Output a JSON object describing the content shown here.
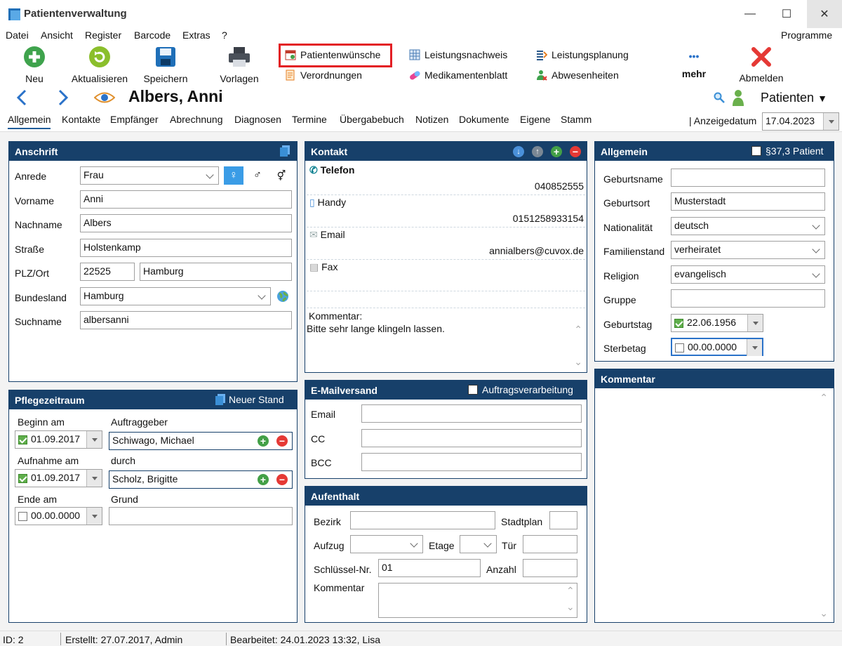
{
  "window": {
    "title": "Patientenverwaltung",
    "minimize": "—",
    "maximize": "☐",
    "close": "✕"
  },
  "menu": {
    "items": [
      "Datei",
      "Ansicht",
      "Register",
      "Barcode",
      "Extras",
      "?"
    ],
    "right": "Programme"
  },
  "toolbar": {
    "neu": "Neu",
    "aktualisieren": "Aktualisieren",
    "speichern": "Speichern",
    "vorlagen": "Vorlagen",
    "patientenwuensche": "Patientenwünsche",
    "verordnungen": "Verordnungen",
    "leistungsnachweis": "Leistungsnachweis",
    "medikamentenblatt": "Medikamentenblatt",
    "leistungsplanung": "Leistungsplanung",
    "abwesenheiten": "Abwesenheiten",
    "mehr_dots": "•••",
    "mehr": "mehr",
    "abmelden": "Abmelden"
  },
  "nav": {
    "patient_name": "Albers, Anni",
    "patienten_label": "Patienten"
  },
  "tabs": [
    "Allgemein",
    "Kontakte",
    "Empfänger",
    "Abrechnung",
    "Diagnosen",
    "Termine",
    "Übergabebuch",
    "Notizen",
    "Dokumente",
    "Eigene",
    "Stamm"
  ],
  "anzeigedatum": {
    "label": "Anzeigedatum",
    "value": "17.04.2023"
  },
  "anschrift": {
    "title": "Anschrift",
    "anrede_label": "Anrede",
    "anrede": "Frau",
    "vorname_label": "Vorname",
    "vorname": "Anni",
    "nachname_label": "Nachname",
    "nachname": "Albers",
    "strasse_label": "Straße",
    "strasse": "Holstenkamp",
    "plzort_label": "PLZ/Ort",
    "plz": "22525",
    "ort": "Hamburg",
    "bundesland_label": "Bundesland",
    "bundesland": "Hamburg",
    "suchname_label": "Suchname",
    "suchname": "albersanni",
    "female": "♀",
    "male": "♂",
    "other": "⚥"
  },
  "kontakt": {
    "title": "Kontakt",
    "telefon_label": "Telefon",
    "telefon": "040852555",
    "handy_label": "Handy",
    "handy": "0151258933154",
    "email_label": "Email",
    "email": "annialbers@cuvox.de",
    "fax_label": "Fax",
    "kommentar_label": "Kommentar:",
    "kommentar": "Bitte sehr lange klingeln lassen."
  },
  "allgemein": {
    "title": "Allgemein",
    "paragraph_label": "§37,3 Patient",
    "geburtsname_label": "Geburtsname",
    "geburtsname": "",
    "geburtsort_label": "Geburtsort",
    "geburtsort": "Musterstadt",
    "nationalitaet_label": "Nationalität",
    "nationalitaet": "deutsch",
    "familienstand_label": "Familienstand",
    "familienstand": "verheiratet",
    "religion_label": "Religion",
    "religion": "evangelisch",
    "gruppe_label": "Gruppe",
    "gruppe": "",
    "geburtstag_label": "Geburtstag",
    "geburtstag": "22.06.1956",
    "sterbetag_label": "Sterbetag",
    "sterbetag": "00.00.0000"
  },
  "pflegezeitraum": {
    "title": "Pflegezeitraum",
    "neuer_stand": "Neuer Stand",
    "beginn_label": "Beginn am",
    "beginn": "01.09.2017",
    "auftraggeber_label": "Auftraggeber",
    "auftraggeber": "Schiwago, Michael",
    "aufnahme_label": "Aufnahme am",
    "aufnahme": "01.09.2017",
    "durch_label": "durch",
    "durch": "Scholz, Brigitte",
    "ende_label": "Ende am",
    "ende": "00.00.0000",
    "grund_label": "Grund",
    "grund": ""
  },
  "emailversand": {
    "title": "E-Mailversand",
    "auftrag_label": "Auftragsverarbeitung",
    "email_label": "Email",
    "cc_label": "CC",
    "bcc_label": "BCC"
  },
  "aufenthalt": {
    "title": "Aufenthalt",
    "bezirk_label": "Bezirk",
    "stadtplan_label": "Stadtplan",
    "aufzug_label": "Aufzug",
    "etage_label": "Etage",
    "tuer_label": "Tür",
    "schluessel_label": "Schlüssel-Nr.",
    "schluessel": "01",
    "anzahl_label": "Anzahl",
    "kommentar_label": "Kommentar"
  },
  "kommentar": {
    "title": "Kommentar"
  },
  "status": {
    "id": "ID: 2",
    "erstellt": "Erstellt: 27.07.2017, Admin",
    "bearbeitet": "Bearbeitet: 24.01.2023 13:32, Lisa"
  },
  "colors": {
    "panel_header": "#17406a",
    "highlight": "#e31e24",
    "add": "#43a047",
    "remove": "#e53935"
  }
}
